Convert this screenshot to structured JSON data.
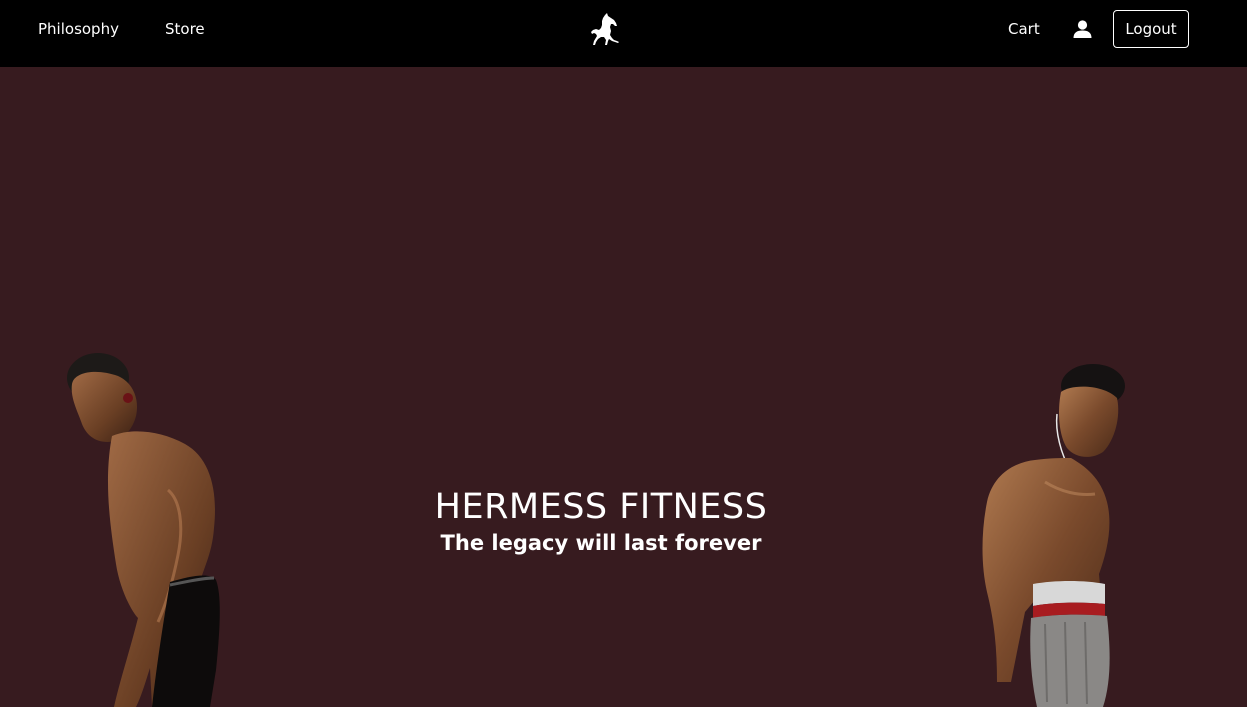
{
  "nav": {
    "philosophy_label": "Philosophy",
    "store_label": "Store",
    "cart_label": "Cart",
    "logout_label": "Logout",
    "logo_icon": "rearing-horse-icon",
    "user_icon": "user-icon"
  },
  "hero": {
    "title": "HERMESS FITNESS",
    "subtitle": "The legacy will last forever",
    "background_color": "#371b1f"
  },
  "colors": {
    "navbar": "#000000",
    "text": "#ffffff"
  }
}
